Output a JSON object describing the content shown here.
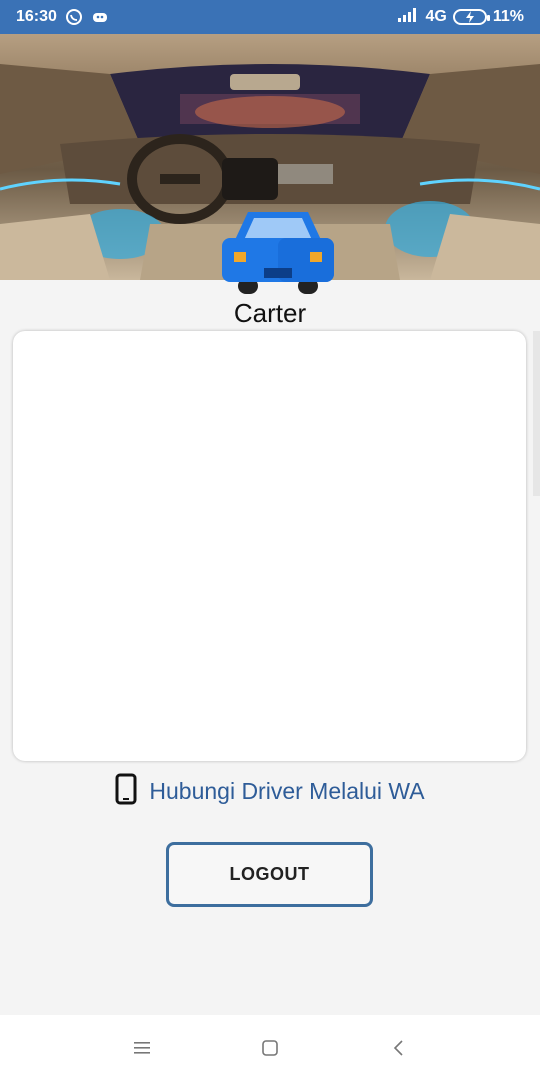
{
  "status_bar": {
    "time": "16:30",
    "network": "4G",
    "battery": "11%",
    "icons": [
      "whatsapp-icon",
      "notification-icon",
      "signal-icon",
      "battery-charging-icon"
    ]
  },
  "header": {
    "image": "car-interior-photo",
    "badge_icon": "car-icon"
  },
  "service": {
    "title": "Carter"
  },
  "contact": {
    "icon": "phone-icon",
    "label": "Hubungi Driver Melalui WA"
  },
  "actions": {
    "logout_label": "LOGOUT"
  },
  "nav_bar": {
    "items": [
      "menu-icon",
      "home-icon",
      "back-icon"
    ]
  },
  "colors": {
    "status_bar": "#3a72b6",
    "accent_text": "#2e5c98",
    "button_border": "#3d6e9e",
    "car_body": "#1f78e6",
    "background": "#f4f4f4"
  }
}
